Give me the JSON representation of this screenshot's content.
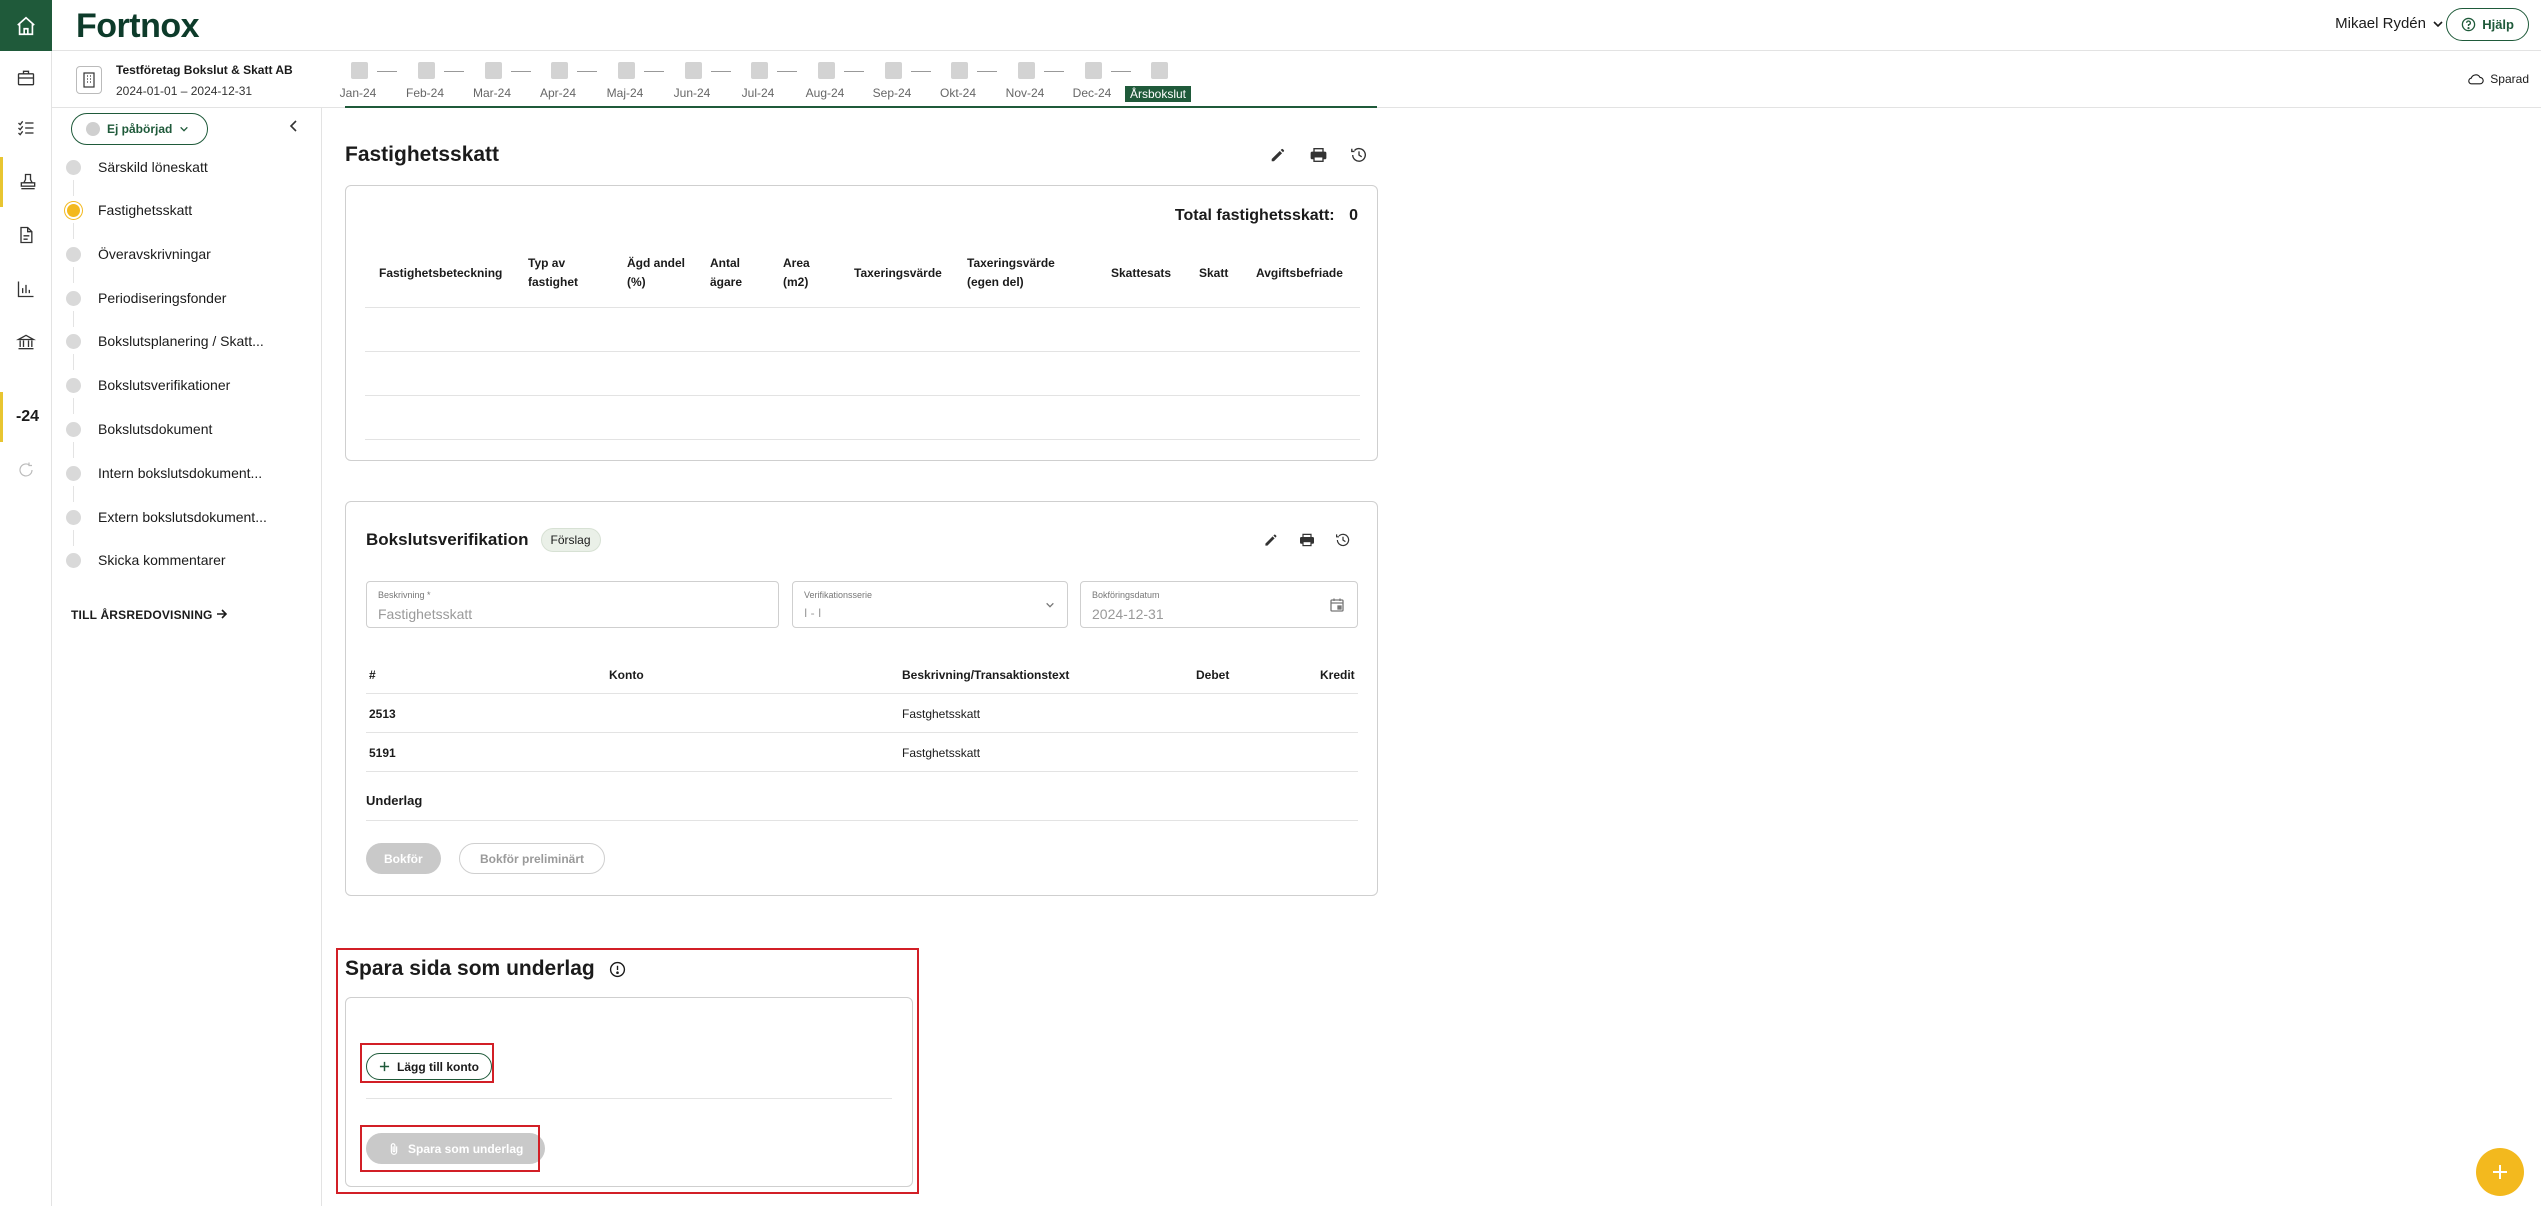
{
  "app": {
    "logo": "Fortnox"
  },
  "header": {
    "user_name": "Mikael Rydén",
    "help_label": "Hjälp"
  },
  "rail": {
    "year_label": "-24"
  },
  "company": {
    "name": "Testföretag Bokslut & Skatt AB",
    "period": "2024-01-01 – 2024-12-31"
  },
  "months": [
    "Jan-24",
    "Feb-24",
    "Mar-24",
    "Apr-24",
    "Maj-24",
    "Jun-24",
    "Jul-24",
    "Aug-24",
    "Sep-24",
    "Okt-24",
    "Nov-24",
    "Dec-24",
    "Årsbokslut"
  ],
  "saved_label": "Sparad",
  "sidebar": {
    "status_label": "Ej påbörjad",
    "steps": [
      "Särskild löneskatt",
      "Fastighetsskatt",
      "Överavskrivningar",
      "Periodiseringsfonder",
      "Bokslutsplanering / Skatt...",
      "Bokslutsverifikationer",
      "Bokslutsdokument",
      "Intern bokslutsdokument...",
      "Extern bokslutsdokument...",
      "Skicka kommentarer"
    ],
    "to_annual_label": "TILL ÅRSREDOVISNING"
  },
  "property_tax": {
    "title": "Fastighetsskatt",
    "total_label": "Total fastighetsskatt:",
    "total_value": "0",
    "columns": [
      "Fastighetsbeteckning",
      "Typ av fastighet",
      "Ägd andel (%)",
      "Antal ägare",
      "Area (m2)",
      "Taxeringsvärde",
      "Taxeringsvärde (egen del)",
      "Skattesats",
      "Skatt",
      "Avgiftsbefriade"
    ]
  },
  "voucher": {
    "title": "Bokslutsverifikation",
    "badge": "Förslag",
    "description_label": "Beskrivning *",
    "description_value": "Fastighetsskatt",
    "series_label": "Verifikationsserie",
    "series_value": "I - I",
    "date_label": "Bokföringsdatum",
    "date_value": "2024-12-31",
    "columns": {
      "nr": "#",
      "account": "Konto",
      "description": "Beskrivning/Transaktionstext",
      "debit": "Debet",
      "credit": "Kredit"
    },
    "rows": [
      {
        "nr": "2513",
        "description": "Fastghetsskatt"
      },
      {
        "nr": "5191",
        "description": "Fastghetsskatt"
      }
    ],
    "attachment_label": "Underlag",
    "book_button": "Bokför",
    "book_prelim_button": "Bokför preliminärt"
  },
  "save_page": {
    "title": "Spara sida som underlag",
    "add_account_button": "Lägg till konto",
    "save_button": "Spara som underlag"
  }
}
